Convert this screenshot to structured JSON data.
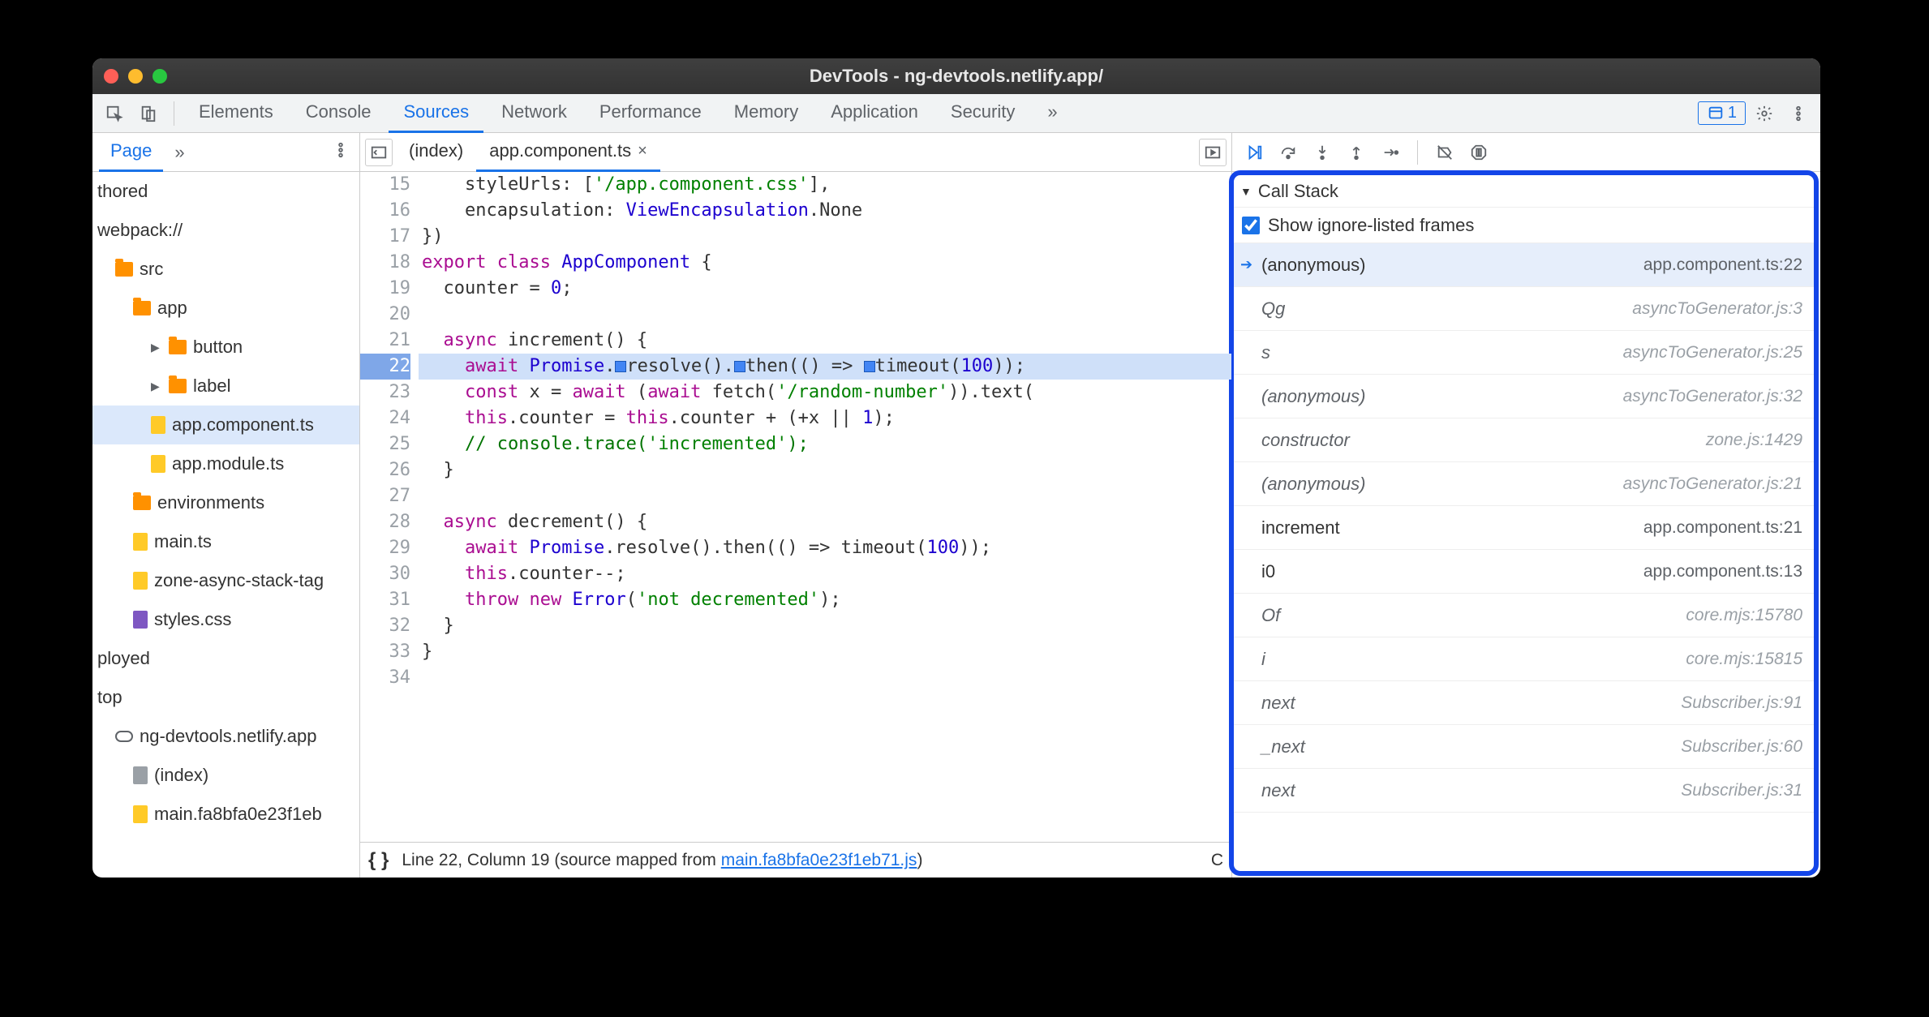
{
  "window_title": "DevTools - ng-devtools.netlify.app/",
  "main_tabs": [
    "Elements",
    "Console",
    "Sources",
    "Network",
    "Performance",
    "Memory",
    "Application",
    "Security"
  ],
  "main_tabs_active": "Sources",
  "issues_count": "1",
  "navigator": {
    "tabs": [
      "Page"
    ],
    "active": "Page",
    "items": [
      {
        "type": "label",
        "text": "thored",
        "indent": 0
      },
      {
        "type": "label",
        "text": "webpack://",
        "indent": 0
      },
      {
        "type": "folder",
        "text": "src",
        "indent": 1
      },
      {
        "type": "folder",
        "text": "app",
        "indent": 2
      },
      {
        "type": "folder",
        "text": "button",
        "indent": 3,
        "arrow": true
      },
      {
        "type": "folder",
        "text": "label",
        "indent": 3,
        "arrow": true
      },
      {
        "type": "file",
        "text": "app.component.ts",
        "indent": 3,
        "selected": true
      },
      {
        "type": "file",
        "text": "app.module.ts",
        "indent": 3
      },
      {
        "type": "folder",
        "text": "environments",
        "indent": 2
      },
      {
        "type": "file",
        "text": "main.ts",
        "indent": 2
      },
      {
        "type": "file",
        "text": "zone-async-stack-tag",
        "indent": 2
      },
      {
        "type": "file",
        "text": "styles.css",
        "indent": 2,
        "color": "purple"
      },
      {
        "type": "label",
        "text": "ployed",
        "indent": 0
      },
      {
        "type": "label",
        "text": "top",
        "indent": 0
      },
      {
        "type": "cloud",
        "text": "ng-devtools.netlify.app",
        "indent": 1
      },
      {
        "type": "file",
        "text": "(index)",
        "indent": 2,
        "color": "gray"
      },
      {
        "type": "file",
        "text": "main.fa8bfa0e23f1eb",
        "indent": 2
      }
    ]
  },
  "editor": {
    "tabs": [
      {
        "label": "(index)",
        "active": false
      },
      {
        "label": "app.component.ts",
        "active": true,
        "closeable": true
      }
    ],
    "first_line_no": 15,
    "current_line_no": 22,
    "lines": [
      {
        "n": 15,
        "raw": "    styleUrls: ['/app.component.css'],",
        "cut": true
      },
      {
        "n": 16,
        "raw": "    encapsulation: ViewEncapsulation.None"
      },
      {
        "n": 17,
        "raw": "})"
      },
      {
        "n": 18,
        "raw": "export class AppComponent {"
      },
      {
        "n": 19,
        "raw": "  counter = 0;"
      },
      {
        "n": 20,
        "raw": ""
      },
      {
        "n": 21,
        "raw": "  async increment() {"
      },
      {
        "n": 22,
        "raw": "    await Promise.resolve().then(() => timeout(100));",
        "cur": true
      },
      {
        "n": 23,
        "raw": "    const x = await (await fetch('/random-number')).text("
      },
      {
        "n": 24,
        "raw": "    this.counter = this.counter + (+x || 1);"
      },
      {
        "n": 25,
        "raw": "    // console.trace('incremented');"
      },
      {
        "n": 26,
        "raw": "  }"
      },
      {
        "n": 27,
        "raw": ""
      },
      {
        "n": 28,
        "raw": "  async decrement() {"
      },
      {
        "n": 29,
        "raw": "    await Promise.resolve().then(() => timeout(100));"
      },
      {
        "n": 30,
        "raw": "    this.counter--;"
      },
      {
        "n": 31,
        "raw": "    throw new Error('not decremented');"
      },
      {
        "n": 32,
        "raw": "  }"
      },
      {
        "n": 33,
        "raw": "}"
      },
      {
        "n": 34,
        "raw": ""
      }
    ],
    "status": {
      "pos": "Line 22, Column 19",
      "mapped_prefix": "(source mapped from ",
      "mapped_link": "main.fa8bfa0e23f1eb71.js",
      "mapped_suffix": ")",
      "coverage": "C"
    }
  },
  "debugger": {
    "callstack_title": "Call Stack",
    "show_ignored_label": "Show ignore-listed frames",
    "show_ignored_checked": true,
    "frames": [
      {
        "name": "(anonymous)",
        "loc": "app.component.ts:22",
        "current": true
      },
      {
        "name": "Qg",
        "loc": "asyncToGenerator.js:3",
        "ignored": true
      },
      {
        "name": "s",
        "loc": "asyncToGenerator.js:25",
        "ignored": true
      },
      {
        "name": "(anonymous)",
        "loc": "asyncToGenerator.js:32",
        "ignored": true
      },
      {
        "name": "constructor",
        "loc": "zone.js:1429",
        "ignored": true
      },
      {
        "name": "(anonymous)",
        "loc": "asyncToGenerator.js:21",
        "ignored": true
      },
      {
        "name": "increment",
        "loc": "app.component.ts:21"
      },
      {
        "name": "i0",
        "loc": "app.component.ts:13"
      },
      {
        "name": "Of",
        "loc": "core.mjs:15780",
        "ignored": true
      },
      {
        "name": "i",
        "loc": "core.mjs:15815",
        "ignored": true
      },
      {
        "name": "next",
        "loc": "Subscriber.js:91",
        "ignored": true
      },
      {
        "name": "_next",
        "loc": "Subscriber.js:60",
        "ignored": true
      },
      {
        "name": "next",
        "loc": "Subscriber.js:31",
        "ignored": true
      }
    ]
  }
}
